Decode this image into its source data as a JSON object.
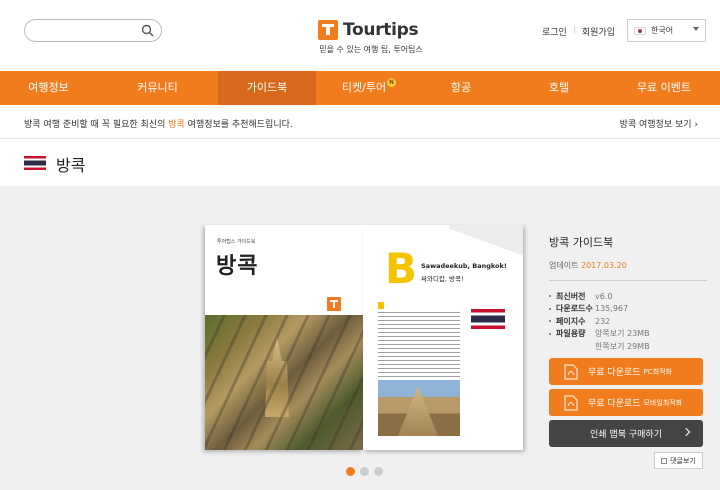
{
  "header": {
    "search_placeholder": "",
    "logo_text": "Tourtips",
    "tagline": "믿을 수 있는 여행 팁, 투어팁스",
    "login": "로그인",
    "signup": "회원가입",
    "language": "한국어"
  },
  "nav": {
    "items": [
      {
        "label": "여행정보"
      },
      {
        "label": "커뮤니티"
      },
      {
        "label": "가이드북"
      },
      {
        "label": "티켓/투어"
      },
      {
        "label": "항공"
      },
      {
        "label": "호텔"
      },
      {
        "label": "무료 이벤트"
      }
    ],
    "badge": "N"
  },
  "notice": {
    "before": "방콕 여행 준비할 때 꼭 필요한 최신의 ",
    "highlight": "방콕",
    "after": " 여행정보를 추천해드립니다.",
    "link": "방콕 여행정보 보기 "
  },
  "page": {
    "title": "방콕"
  },
  "book": {
    "left_sub": "투어팁스 가이드북",
    "left_title": "방콕",
    "right_greeting": "Sawadeekub, Bangkok!",
    "right_greeting_kr": "싸와디캅, 방콕!"
  },
  "info": {
    "title": "방콕 가이드북",
    "date_label": "업데이트 ",
    "date_value": "2017.03.20",
    "rows": [
      {
        "label": "최신버전",
        "value": "v6.0"
      },
      {
        "label": "다운로드수",
        "value": "135,967"
      },
      {
        "label": "페이지수",
        "value": "232"
      },
      {
        "label": "파일용량",
        "value": "양쪽보기 23MB"
      },
      {
        "label": "",
        "value": "한쪽보기 29MB"
      }
    ],
    "btn_pc_label": "무료 다운로드",
    "btn_pc_suffix": "PC최적화",
    "btn_mobile_label": "무료 다운로드",
    "btn_mobile_suffix": "모바일최적화",
    "btn_print": "인쇄 맵북 구매하기",
    "comment": "댓글보기"
  },
  "colors": {
    "accent": "#f07c1d",
    "nav_active": "#d9691a",
    "dark_button": "#444444"
  }
}
